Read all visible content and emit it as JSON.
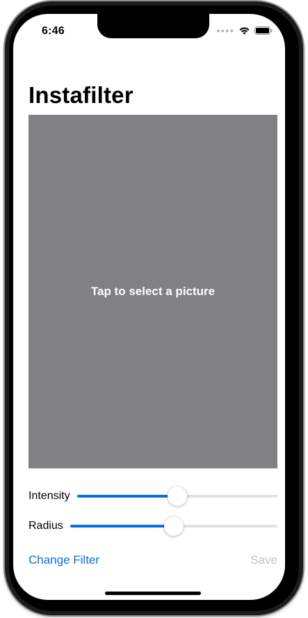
{
  "status_bar": {
    "time": "6:46",
    "signal_icon": "cellular-dots-icon",
    "wifi_icon": "wifi-icon",
    "battery_icon": "battery-icon"
  },
  "nav": {
    "title": "Instafilter"
  },
  "image_area": {
    "prompt": "Tap to select a picture",
    "background_color": "#808085"
  },
  "sliders": [
    {
      "label": "Intensity",
      "value": 0.5
    },
    {
      "label": "Radius",
      "value": 0.5
    }
  ],
  "actions": {
    "change_filter_label": "Change Filter",
    "save_label": "Save"
  },
  "colors": {
    "accent": "#0a6ddf",
    "disabled": "#c2c2c6",
    "track": "#e3e3e6"
  }
}
